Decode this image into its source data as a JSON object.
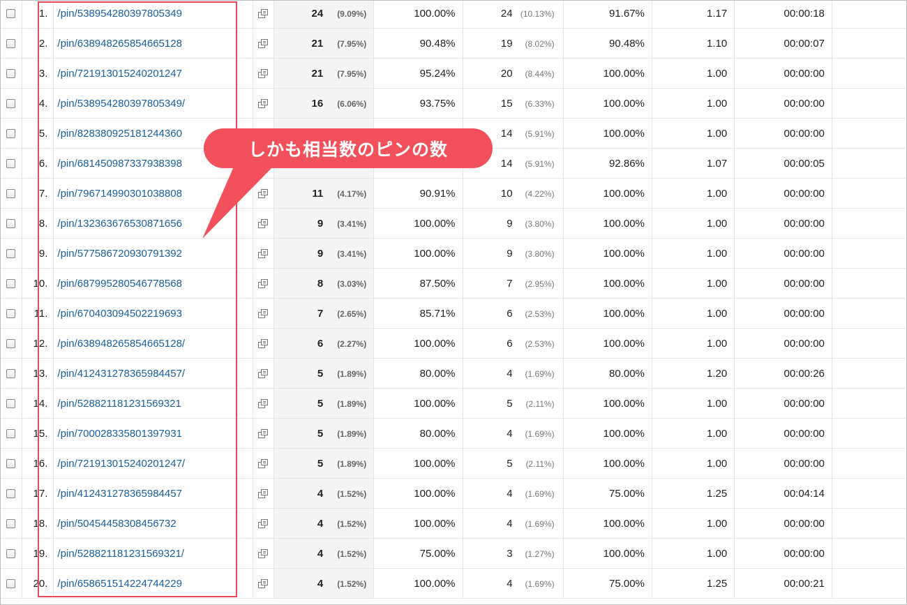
{
  "callout": {
    "text": "しかも相当数のピンの数"
  },
  "rows": [
    {
      "index": "1.",
      "page": "/pin/538954280397805349",
      "pageviews": "24",
      "pv_share": "(9.09%)",
      "col_pct": "100.00%",
      "unique_pv": "24",
      "upv_share": "(10.13%)",
      "entrance_rate": "91.67%",
      "pages_per_session": "1.17",
      "duration": "00:00:18"
    },
    {
      "index": "2.",
      "page": "/pin/638948265854665128",
      "pageviews": "21",
      "pv_share": "(7.95%)",
      "col_pct": "90.48%",
      "unique_pv": "19",
      "upv_share": "(8.02%)",
      "entrance_rate": "90.48%",
      "pages_per_session": "1.10",
      "duration": "00:00:07"
    },
    {
      "index": "3.",
      "page": "/pin/721913015240201247",
      "pageviews": "21",
      "pv_share": "(7.95%)",
      "col_pct": "95.24%",
      "unique_pv": "20",
      "upv_share": "(8.44%)",
      "entrance_rate": "100.00%",
      "pages_per_session": "1.00",
      "duration": "00:00:00"
    },
    {
      "index": "4.",
      "page": "/pin/538954280397805349/",
      "pageviews": "16",
      "pv_share": "(6.06%)",
      "col_pct": "93.75%",
      "unique_pv": "15",
      "upv_share": "(6.33%)",
      "entrance_rate": "100.00%",
      "pages_per_session": "1.00",
      "duration": "00:00:00"
    },
    {
      "index": "5.",
      "page": "/pin/828380925181244360",
      "pageviews": "",
      "pv_share": "",
      "col_pct": "",
      "unique_pv": "14",
      "upv_share": "(5.91%)",
      "entrance_rate": "100.00%",
      "pages_per_session": "1.00",
      "duration": "00:00:00"
    },
    {
      "index": "6.",
      "page": "/pin/681450987337938398",
      "pageviews": "",
      "pv_share": "",
      "col_pct": "",
      "unique_pv": "14",
      "upv_share": "(5.91%)",
      "entrance_rate": "92.86%",
      "pages_per_session": "1.07",
      "duration": "00:00:05"
    },
    {
      "index": "7.",
      "page": "/pin/796714990301038808",
      "pageviews": "11",
      "pv_share": "(4.17%)",
      "col_pct": "90.91%",
      "unique_pv": "10",
      "upv_share": "(4.22%)",
      "entrance_rate": "100.00%",
      "pages_per_session": "1.00",
      "duration": "00:00:00"
    },
    {
      "index": "8.",
      "page": "/pin/132363676530871656",
      "pageviews": "9",
      "pv_share": "(3.41%)",
      "col_pct": "100.00%",
      "unique_pv": "9",
      "upv_share": "(3.80%)",
      "entrance_rate": "100.00%",
      "pages_per_session": "1.00",
      "duration": "00:00:00"
    },
    {
      "index": "9.",
      "page": "/pin/577586720930791392",
      "pageviews": "9",
      "pv_share": "(3.41%)",
      "col_pct": "100.00%",
      "unique_pv": "9",
      "upv_share": "(3.80%)",
      "entrance_rate": "100.00%",
      "pages_per_session": "1.00",
      "duration": "00:00:00"
    },
    {
      "index": "10.",
      "page": "/pin/687995280546778568",
      "pageviews": "8",
      "pv_share": "(3.03%)",
      "col_pct": "87.50%",
      "unique_pv": "7",
      "upv_share": "(2.95%)",
      "entrance_rate": "100.00%",
      "pages_per_session": "1.00",
      "duration": "00:00:00"
    },
    {
      "index": "11.",
      "page": "/pin/670403094502219693",
      "pageviews": "7",
      "pv_share": "(2.65%)",
      "col_pct": "85.71%",
      "unique_pv": "6",
      "upv_share": "(2.53%)",
      "entrance_rate": "100.00%",
      "pages_per_session": "1.00",
      "duration": "00:00:00"
    },
    {
      "index": "12.",
      "page": "/pin/638948265854665128/",
      "pageviews": "6",
      "pv_share": "(2.27%)",
      "col_pct": "100.00%",
      "unique_pv": "6",
      "upv_share": "(2.53%)",
      "entrance_rate": "100.00%",
      "pages_per_session": "1.00",
      "duration": "00:00:00"
    },
    {
      "index": "13.",
      "page": "/pin/412431278365984457/",
      "pageviews": "5",
      "pv_share": "(1.89%)",
      "col_pct": "80.00%",
      "unique_pv": "4",
      "upv_share": "(1.69%)",
      "entrance_rate": "80.00%",
      "pages_per_session": "1.20",
      "duration": "00:00:26"
    },
    {
      "index": "14.",
      "page": "/pin/528821181231569321",
      "pageviews": "5",
      "pv_share": "(1.89%)",
      "col_pct": "100.00%",
      "unique_pv": "5",
      "upv_share": "(2.11%)",
      "entrance_rate": "100.00%",
      "pages_per_session": "1.00",
      "duration": "00:00:00"
    },
    {
      "index": "15.",
      "page": "/pin/700028335801397931",
      "pageviews": "5",
      "pv_share": "(1.89%)",
      "col_pct": "80.00%",
      "unique_pv": "4",
      "upv_share": "(1.69%)",
      "entrance_rate": "100.00%",
      "pages_per_session": "1.00",
      "duration": "00:00:00"
    },
    {
      "index": "16.",
      "page": "/pin/721913015240201247/",
      "pageviews": "5",
      "pv_share": "(1.89%)",
      "col_pct": "100.00%",
      "unique_pv": "5",
      "upv_share": "(2.11%)",
      "entrance_rate": "100.00%",
      "pages_per_session": "1.00",
      "duration": "00:00:00"
    },
    {
      "index": "17.",
      "page": "/pin/412431278365984457",
      "pageviews": "4",
      "pv_share": "(1.52%)",
      "col_pct": "100.00%",
      "unique_pv": "4",
      "upv_share": "(1.69%)",
      "entrance_rate": "75.00%",
      "pages_per_session": "1.25",
      "duration": "00:04:14"
    },
    {
      "index": "18.",
      "page": "/pin/50454458308456732",
      "pageviews": "4",
      "pv_share": "(1.52%)",
      "col_pct": "100.00%",
      "unique_pv": "4",
      "upv_share": "(1.69%)",
      "entrance_rate": "100.00%",
      "pages_per_session": "1.00",
      "duration": "00:00:00"
    },
    {
      "index": "19.",
      "page": "/pin/528821181231569321/",
      "pageviews": "4",
      "pv_share": "(1.52%)",
      "col_pct": "75.00%",
      "unique_pv": "3",
      "upv_share": "(1.27%)",
      "entrance_rate": "100.00%",
      "pages_per_session": "1.00",
      "duration": "00:00:00"
    },
    {
      "index": "20.",
      "page": "/pin/658651514224744229",
      "pageviews": "4",
      "pv_share": "(1.52%)",
      "col_pct": "100.00%",
      "unique_pv": "4",
      "upv_share": "(1.69%)",
      "entrance_rate": "75.00%",
      "pages_per_session": "1.25",
      "duration": "00:00:21"
    }
  ]
}
